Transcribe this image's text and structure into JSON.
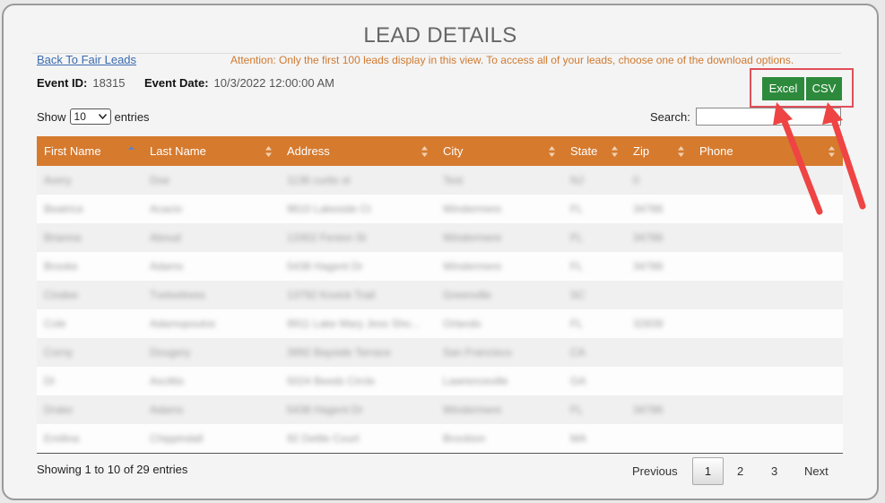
{
  "page": {
    "title": "LEAD DETAILS",
    "back_link": "Back To Fair Leads",
    "attention": "Attention: Only the first 100 leads display in this view. To access all of your leads, choose one of the download options."
  },
  "event": {
    "id_label": "Event ID:",
    "id_value": "18315",
    "date_label": "Event Date:",
    "date_value": "10/3/2022 12:00:00 AM"
  },
  "downloads": {
    "excel": "Excel",
    "csv": "CSV"
  },
  "controls": {
    "show_label": "Show",
    "entries_value": "10",
    "entries_label": "entries",
    "search_label": "Search:"
  },
  "table": {
    "headers": [
      "First Name",
      "Last Name",
      "Address",
      "City",
      "State",
      "Zip",
      "Phone"
    ],
    "rows": [
      [
        "Avery",
        "Doe",
        "1136 curtis st",
        "Test",
        "NJ",
        "0",
        ""
      ],
      [
        "Beatrice",
        "Acacio",
        "9610 Lakeside Ct",
        "Windermere",
        "FL",
        "34786",
        ""
      ],
      [
        "Brianna",
        "Aboud",
        "13302 Fenion St",
        "Windermere",
        "FL",
        "34786",
        ""
      ],
      [
        "Brooke",
        "Adams",
        "5438 Hagent Dr",
        "Windermere",
        "FL",
        "34786",
        ""
      ],
      [
        "Cindee",
        "Tvelvetrees",
        "13792 Kovick Trail",
        "Greenville",
        "SC",
        "",
        ""
      ],
      [
        "Cole",
        "Adamopoulos",
        "9911 Lake Mary Jess Sho...",
        "Orlando",
        "FL",
        "32839",
        ""
      ],
      [
        "Corny",
        "Dougery",
        "3992 Bayside Terrace",
        "San Francisco",
        "CA",
        "",
        ""
      ],
      [
        "DI",
        "Ascittis",
        "5024 Beeds Circle",
        "Lawrenceville",
        "GA",
        "",
        ""
      ],
      [
        "Drake",
        "Adams",
        "5438 Hagent Dr",
        "Windermere",
        "FL",
        "34786",
        ""
      ],
      [
        "Emilina",
        "Chippindall",
        "92 Dettle Court",
        "Brockton",
        "MA",
        "",
        ""
      ]
    ]
  },
  "footer": {
    "info": "Showing 1 to 10 of 29 entries",
    "previous": "Previous",
    "pages": [
      "1",
      "2",
      "3"
    ],
    "next": "Next"
  },
  "colors": {
    "header_orange": "#d67a2e",
    "button_green": "#2d8a3c",
    "highlight_red": "#e0505a",
    "attention_orange": "#d07a30"
  }
}
